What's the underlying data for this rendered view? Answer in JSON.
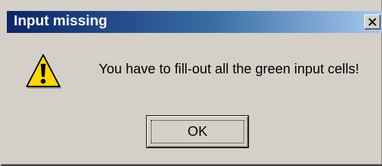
{
  "window": {
    "title": "Input missing",
    "close_label": "×"
  },
  "message": {
    "text": "You have to fill-out all the green input cells!",
    "icon": "warning-icon"
  },
  "buttons": {
    "ok_label": "OK"
  },
  "colors": {
    "titlebar_start": "#0a246a",
    "titlebar_end": "#a6caf0",
    "dialog_face": "#d4d0c8",
    "warning_yellow": "#ffd800"
  }
}
